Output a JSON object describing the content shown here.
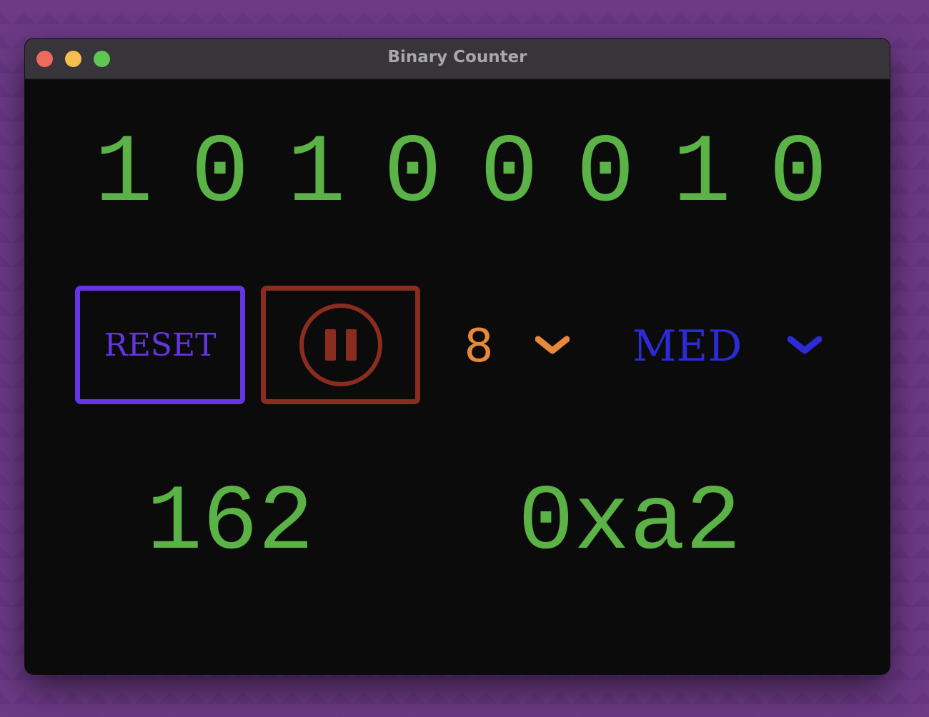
{
  "window": {
    "title": "Binary Counter"
  },
  "counter": {
    "bits": [
      "1",
      "0",
      "1",
      "0",
      "0",
      "0",
      "1",
      "0"
    ],
    "decimal": "162",
    "hex": "0xa2"
  },
  "controls": {
    "reset_label": "RESET",
    "pause_icon": "pause-icon",
    "bit_width": "8",
    "speed": "MED"
  },
  "colors": {
    "digits": "#5bb246",
    "reset": "#6534e3",
    "pause": "#8a2c20",
    "bit_width": "#e7883a",
    "speed": "#2b2bd8"
  }
}
